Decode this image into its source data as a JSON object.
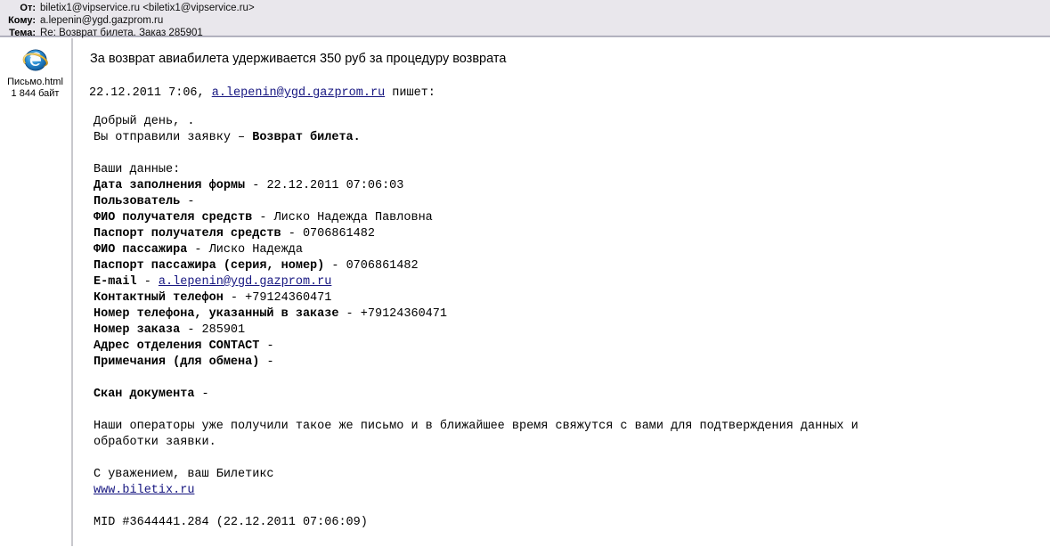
{
  "header": {
    "rows": [
      {
        "label": "От:",
        "value": "biletix1@vipservice.ru <biletix1@vipservice.ru>"
      },
      {
        "label": "Кому:",
        "value": "a.lepenin@ygd.gazprom.ru"
      },
      {
        "label": "Тема:",
        "value": "Re: Возврат билета. Заказ 285901"
      }
    ]
  },
  "attachment": {
    "icon": "internet-explorer-icon",
    "name": "Письмо.html",
    "size": "1 844 байт"
  },
  "message": {
    "notice": "За возврат авиабилета удерживается 350 руб за процедуру возврата",
    "quote_intro": {
      "date": "22.12.2011 7:06,",
      "email": "a.lepenin@ygd.gazprom.ru",
      "suffix": "пишет:"
    },
    "greeting": "Добрый день, .",
    "request_prefix": "Вы отправили заявку – ",
    "request_bold": "Возврат билета.",
    "data_heading": "Ваши данные:",
    "fields": [
      {
        "label": "Дата заполнения формы",
        "sep": " - ",
        "value": "22.12.2011 07:06:03"
      },
      {
        "label": "Пользователь",
        "sep": " -",
        "value": ""
      },
      {
        "label": "ФИО получателя средств",
        "sep": " - ",
        "value": "Лиско Надежда Павловна"
      },
      {
        "label": "Паспорт получателя средств",
        "sep": " - ",
        "value": "0706861482"
      },
      {
        "label": "ФИО пассажира",
        "sep": " - ",
        "value": "Лиско Надежда"
      },
      {
        "label": "Паспорт пассажира (серия, номер)",
        "sep": " - ",
        "value": "0706861482"
      },
      {
        "label": "E-mail",
        "sep": " - ",
        "value": "a.lepenin@ygd.gazprom.ru",
        "is_link": true
      },
      {
        "label": "Контактный телефон",
        "sep": " - ",
        "value": "+79124360471"
      },
      {
        "label": "Номер телефона, указанный в заказе",
        "sep": " - ",
        "value": "+79124360471"
      },
      {
        "label": "Номер заказа",
        "sep": " - ",
        "value": "285901"
      },
      {
        "label": "Адрес отделения CONTACT",
        "sep": " -",
        "value": ""
      },
      {
        "label": "Примечания (для обмена)",
        "sep": " -",
        "value": ""
      }
    ],
    "scan_label": "Скан документа",
    "scan_sep": " -",
    "operators_line1": "Наши операторы уже получили такое же письмо и в ближайшее время свяжутся с вами для подтверждения данных и",
    "operators_line2": "обработки заявки.",
    "signature": "С уважением, ваш Билетикс",
    "site_link": "www.biletix.ru",
    "mid": "MID #3644441.284 (22.12.2011 07:06:09)"
  },
  "colors": {
    "header_bg": "#e9e7ec",
    "link": "#161680",
    "text": "#000000",
    "body_bg": "#ffffff"
  }
}
